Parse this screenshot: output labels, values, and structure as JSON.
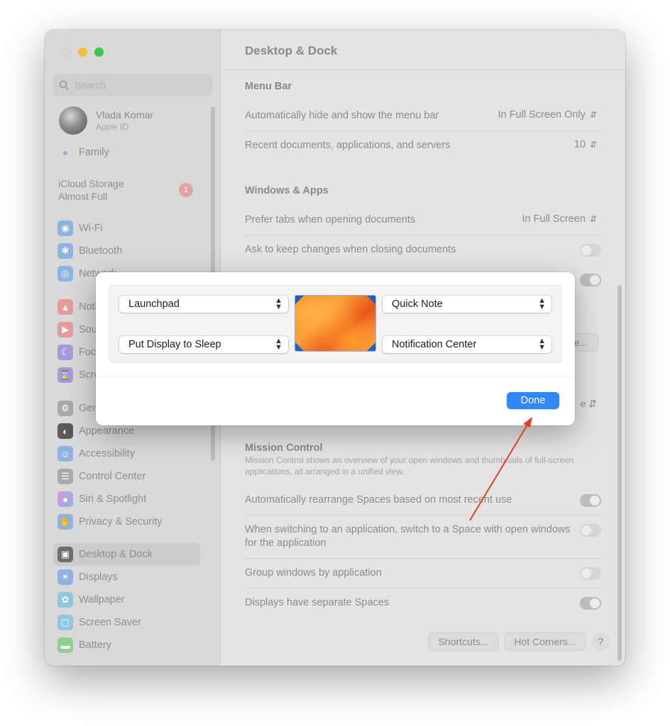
{
  "window": {
    "title": "Desktop & Dock"
  },
  "sidebar": {
    "search_placeholder": "Search",
    "profile": {
      "name": "Vlada Komar",
      "subtitle": "Apple ID"
    },
    "family": "Family",
    "storage": {
      "line1": "iCloud Storage",
      "line2": "Almost Full",
      "badge": "1"
    },
    "items": [
      {
        "label": "Wi-Fi",
        "icon": "wifi-icon",
        "color": "#8fb3e0"
      },
      {
        "label": "Bluetooth",
        "icon": "bluetooth-icon",
        "color": "#8fb3e0"
      },
      {
        "label": "Network",
        "icon": "globe-icon",
        "color": "#8fb3e0"
      },
      {
        "label": "Notifications",
        "icon": "bell-icon",
        "color": "#e79b9b"
      },
      {
        "label": "Sound",
        "icon": "speaker-icon",
        "color": "#e79b9b"
      },
      {
        "label": "Focus",
        "icon": "moon-icon",
        "color": "#a89ad8"
      },
      {
        "label": "Screen Time",
        "icon": "hourglass-icon",
        "color": "#a89ad8"
      },
      {
        "label": "General",
        "icon": "gear-icon",
        "color": "#a9a9a9"
      },
      {
        "label": "Appearance",
        "icon": "appearance-icon",
        "color": "#5a5a5a"
      },
      {
        "label": "Accessibility",
        "icon": "accessibility-icon",
        "color": "#8fb3e0"
      },
      {
        "label": "Control Center",
        "icon": "control-center-icon",
        "color": "#a9a9a9"
      },
      {
        "label": "Siri & Spotlight",
        "icon": "siri-icon",
        "color": "#b68fd8"
      },
      {
        "label": "Privacy & Security",
        "icon": "hand-icon",
        "color": "#8fb3e0"
      },
      {
        "label": "Desktop & Dock",
        "icon": "dock-icon",
        "color": "#6d6d6d"
      },
      {
        "label": "Displays",
        "icon": "sun-icon",
        "color": "#8fb3e0"
      },
      {
        "label": "Wallpaper",
        "icon": "flower-icon",
        "color": "#8fc7e0"
      },
      {
        "label": "Screen Saver",
        "icon": "screensaver-icon",
        "color": "#8fc7e0"
      },
      {
        "label": "Battery",
        "icon": "battery-icon",
        "color": "#8fd08f"
      }
    ]
  },
  "main": {
    "menu_bar": {
      "heading": "Menu Bar",
      "auto_hide_label": "Automatically hide and show the menu bar",
      "auto_hide_value": "In Full Screen Only",
      "recent_label": "Recent documents, applications, and servers",
      "recent_value": "10"
    },
    "windows_apps": {
      "heading": "Windows & Apps",
      "prefer_tabs_label": "Prefer tabs when opening documents",
      "prefer_tabs_value": "In Full Screen",
      "ask_keep_label": "Ask to keep changes when closing documents",
      "ask_keep_on": false
    },
    "partial": {
      "button_text": "ze...",
      "chevron_text": "e"
    },
    "mission_control": {
      "heading": "Mission Control",
      "description": "Mission Control shows an overview of your open windows and thumbnails of full-screen applications, all arranged in a unified view.",
      "rearrange_label": "Automatically rearrange Spaces based on most recent use",
      "rearrange_on": true,
      "switch_label": "When switching to an application, switch to a Space with open windows for the application",
      "switch_on": false,
      "group_label": "Group windows by application",
      "group_on": false,
      "separate_label": "Displays have separate Spaces",
      "separate_on": true
    },
    "buttons": {
      "shortcuts": "Shortcuts...",
      "hot_corners": "Hot Corners...",
      "help": "?"
    }
  },
  "hot_corners_dialog": {
    "top_left": "Launchpad",
    "top_right": "Quick Note",
    "bottom_left": "Put Display to Sleep",
    "bottom_right": "Notification Center",
    "done": "Done"
  },
  "colors": {
    "accent": "#2f88f5",
    "annotation_arrow": "#e0402a"
  }
}
